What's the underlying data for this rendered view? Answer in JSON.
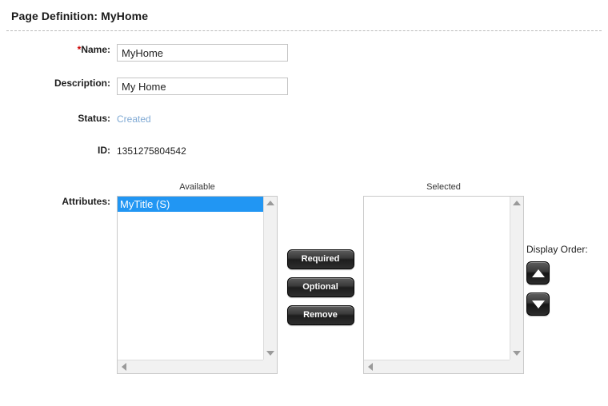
{
  "header": {
    "title": "Page Definition: MyHome"
  },
  "form": {
    "name": {
      "label": "Name:",
      "required_marker": "*",
      "value": "MyHome",
      "placeholder": ""
    },
    "description": {
      "label": "Description:",
      "value": "My Home",
      "placeholder": ""
    },
    "status": {
      "label": "Status:",
      "value": "Created"
    },
    "id": {
      "label": "ID:",
      "value": "1351275804542"
    },
    "attributes": {
      "label": "Attributes:",
      "available": {
        "caption": "Available",
        "items": [
          {
            "label": "MyTitle (S)",
            "selected": true
          }
        ]
      },
      "selected": {
        "caption": "Selected",
        "items": []
      }
    }
  },
  "buttons": {
    "required": "Required",
    "optional": "Optional",
    "remove": "Remove"
  },
  "display_order": {
    "label": "Display Order:",
    "move_up_icon": "triangle-up-icon",
    "move_down_icon": "triangle-down-icon"
  },
  "icons": {
    "scroll_up": "scroll-arrow-up-icon",
    "scroll_down": "scroll-arrow-down-icon",
    "scroll_left": "scroll-arrow-left-icon",
    "scroll_right": "scroll-arrow-right-icon"
  },
  "colors": {
    "selection_blue": "#2196f3",
    "status_text": "#7fa9d4",
    "required_star": "#cc0000",
    "button_dark": "#2e2e2e"
  }
}
